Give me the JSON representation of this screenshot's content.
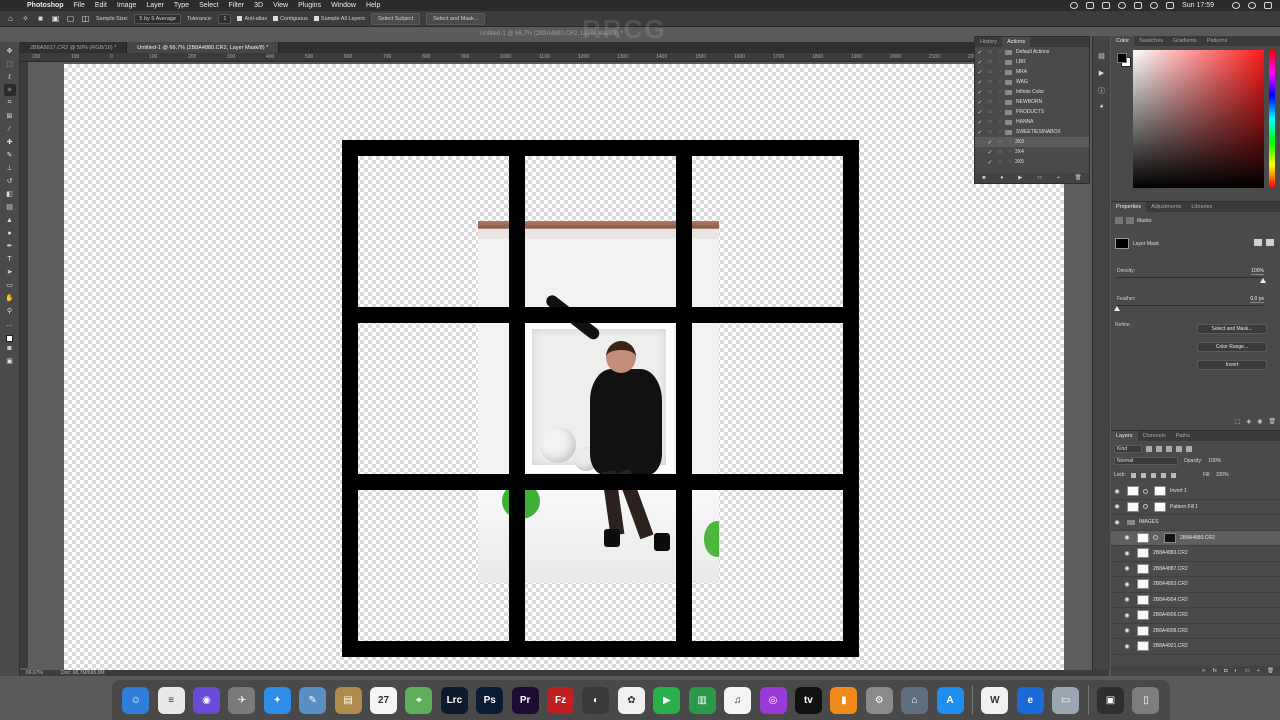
{
  "menubar": {
    "app": "Photoshop",
    "items": [
      "File",
      "Edit",
      "Image",
      "Layer",
      "Type",
      "Select",
      "Filter",
      "3D",
      "View",
      "Plugins",
      "Window",
      "Help"
    ],
    "clock": "Sun 17:59"
  },
  "options": {
    "sample_size_label": "Sample Size:",
    "sample_size_value": "5 by 5 Average",
    "tolerance_label": "Tolerance:",
    "tolerance_value": "1",
    "anti_alias": "Anti-alias",
    "contiguous": "Contiguous",
    "sample_all": "Sample All Layers",
    "select_subject": "Select Subject",
    "select_and_mask": "Select and Mask..."
  },
  "document": {
    "title": "Untitled-1 @ 66,7% (2B8A4880.CR2, Layer Mask/8) *",
    "tabs": [
      {
        "label": "2B8A5017.CR2 @ 50% (RGB/16) *"
      },
      {
        "label": "Untitled-1 @ 66,7% (2B8A4880.CR2, Layer Mask/8) *"
      }
    ],
    "ruler_marks": [
      "200",
      "100",
      "0",
      "100",
      "200",
      "300",
      "400",
      "500",
      "600",
      "700",
      "800",
      "900",
      "1000",
      "1100",
      "1200",
      "1300",
      "1400",
      "1500",
      "1600",
      "1700",
      "1800",
      "1900",
      "2000",
      "2100",
      "2200"
    ]
  },
  "status": {
    "zoom": "66,67%",
    "doc": "Doc: 68,7M/665,0M"
  },
  "actions_panel": {
    "tabs": [
      "History",
      "Actions"
    ],
    "active_tab": "Actions",
    "items": [
      {
        "label": "Default Actions",
        "type": "set"
      },
      {
        "label": "LBR",
        "type": "set"
      },
      {
        "label": "MRA",
        "type": "set"
      },
      {
        "label": "WAG",
        "type": "set"
      },
      {
        "label": "Infinite Color",
        "type": "set"
      },
      {
        "label": "NEWBORN",
        "type": "set"
      },
      {
        "label": "PRODUCTS",
        "type": "set"
      },
      {
        "label": "HANNA",
        "type": "set"
      },
      {
        "label": "SWEETIESINABOX",
        "type": "set"
      },
      {
        "label": "3X3",
        "type": "action"
      },
      {
        "label": "3X4",
        "type": "action"
      },
      {
        "label": "3X5",
        "type": "action"
      }
    ]
  },
  "color_panel": {
    "tabs": [
      "Color",
      "Swatches",
      "Gradients",
      "Patterns"
    ],
    "active_tab": "Color"
  },
  "properties_panel": {
    "tabs": [
      "Properties",
      "Adjustments",
      "Libraries"
    ],
    "active_tab": "Properties",
    "subtitle": "Masks",
    "mask_label": "Layer Mask",
    "density_label": "Density:",
    "density_value": "100%",
    "density": 1.0,
    "feather_label": "Feather:",
    "feather_value": "0,0 px",
    "feather": 0.0,
    "refine_label": "Refine:",
    "buttons": [
      "Select and Mask...",
      "Color Range...",
      "Invert"
    ]
  },
  "layers_panel": {
    "tabs": [
      "Layers",
      "Channels",
      "Paths"
    ],
    "active_tab": "Layers",
    "filter": "Kind",
    "blend_mode": "Normal",
    "opacity_label": "Opacity:",
    "opacity": "100%",
    "lock_label": "Lock:",
    "fill_label": "Fill:",
    "fill": "100%",
    "layers": [
      {
        "name": "Invert 1",
        "kind": "adjust",
        "selected": false
      },
      {
        "name": "Pattern Fill 1",
        "kind": "fill",
        "selected": false
      },
      {
        "name": "IMAGES",
        "kind": "group",
        "selected": false
      },
      {
        "name": "2B8A4880.CR2",
        "kind": "masked",
        "selected": true
      },
      {
        "name": "2B8A4883.CR2",
        "kind": "smart",
        "selected": false
      },
      {
        "name": "2B8A4887.CR2",
        "kind": "smart",
        "selected": false
      },
      {
        "name": "2B8A4893.CR2",
        "kind": "smart",
        "selected": false
      },
      {
        "name": "2B8A4904.CR2",
        "kind": "smart",
        "selected": false
      },
      {
        "name": "2B8A4906.CR2",
        "kind": "smart",
        "selected": false
      },
      {
        "name": "2B8A4908.CR2",
        "kind": "smart",
        "selected": false
      },
      {
        "name": "2B8A4921.CR2",
        "kind": "smart",
        "selected": false
      }
    ]
  },
  "dock": {
    "apps": [
      {
        "name": "Finder",
        "glyph": "☺",
        "color": "#2f7fd8"
      },
      {
        "name": "Notes",
        "glyph": "≡",
        "color": "#e9e9e9"
      },
      {
        "name": "Siri",
        "glyph": "◉",
        "color": "#6a4bd8"
      },
      {
        "name": "Launchpad",
        "glyph": "✈",
        "color": "#7a7a7a"
      },
      {
        "name": "Safari",
        "glyph": "✦",
        "color": "#2e8ee6"
      },
      {
        "name": "Preview",
        "glyph": "✎",
        "color": "#5a8fc4"
      },
      {
        "name": "Notebook",
        "glyph": "▤",
        "color": "#b08a4a"
      },
      {
        "name": "Calendar",
        "glyph": "27",
        "color": "#f5f5f5"
      },
      {
        "name": "Maps",
        "glyph": "⌖",
        "color": "#5fae5a"
      },
      {
        "name": "Lightroom Classic",
        "glyph": "Lrc",
        "color": "#0d1a2b"
      },
      {
        "name": "Photoshop",
        "glyph": "Ps",
        "color": "#0b1b33"
      },
      {
        "name": "Premiere Pro",
        "glyph": "Pr",
        "color": "#1d0b33"
      },
      {
        "name": "FileZilla",
        "glyph": "Fz",
        "color": "#c02020"
      },
      {
        "name": "Migrate",
        "glyph": "◐",
        "color": "#3a3a3a"
      },
      {
        "name": "Photos",
        "glyph": "✿",
        "color": "#f0f0f0"
      },
      {
        "name": "FaceTime",
        "glyph": "▶",
        "color": "#2ab04a"
      },
      {
        "name": "Numbers",
        "glyph": "▥",
        "color": "#2a9a4a"
      },
      {
        "name": "Music",
        "glyph": "♫",
        "color": "#f4f4f4"
      },
      {
        "name": "Podcasts",
        "glyph": "◎",
        "color": "#9a3bd8"
      },
      {
        "name": "TV",
        "glyph": "tv",
        "color": "#111111"
      },
      {
        "name": "Books",
        "glyph": "▮",
        "color": "#f08a1a"
      },
      {
        "name": "System Preferences",
        "glyph": "⚙",
        "color": "#8a8a8a"
      },
      {
        "name": "Migration",
        "glyph": "⌂",
        "color": "#5f6f7f"
      },
      {
        "name": "App Store",
        "glyph": "A",
        "color": "#1e8ef0"
      },
      {
        "name": "Webex",
        "glyph": "W",
        "color": "#f0f0f0"
      },
      {
        "name": "Edge",
        "glyph": "e",
        "color": "#1a6ad8"
      },
      {
        "name": "Screen",
        "glyph": "▭",
        "color": "#9aa6b2"
      },
      {
        "name": "Printer",
        "glyph": "▣",
        "color": "#2e2e2e"
      },
      {
        "name": "Trash",
        "glyph": "▯",
        "color": "#7d7d7d"
      }
    ]
  }
}
